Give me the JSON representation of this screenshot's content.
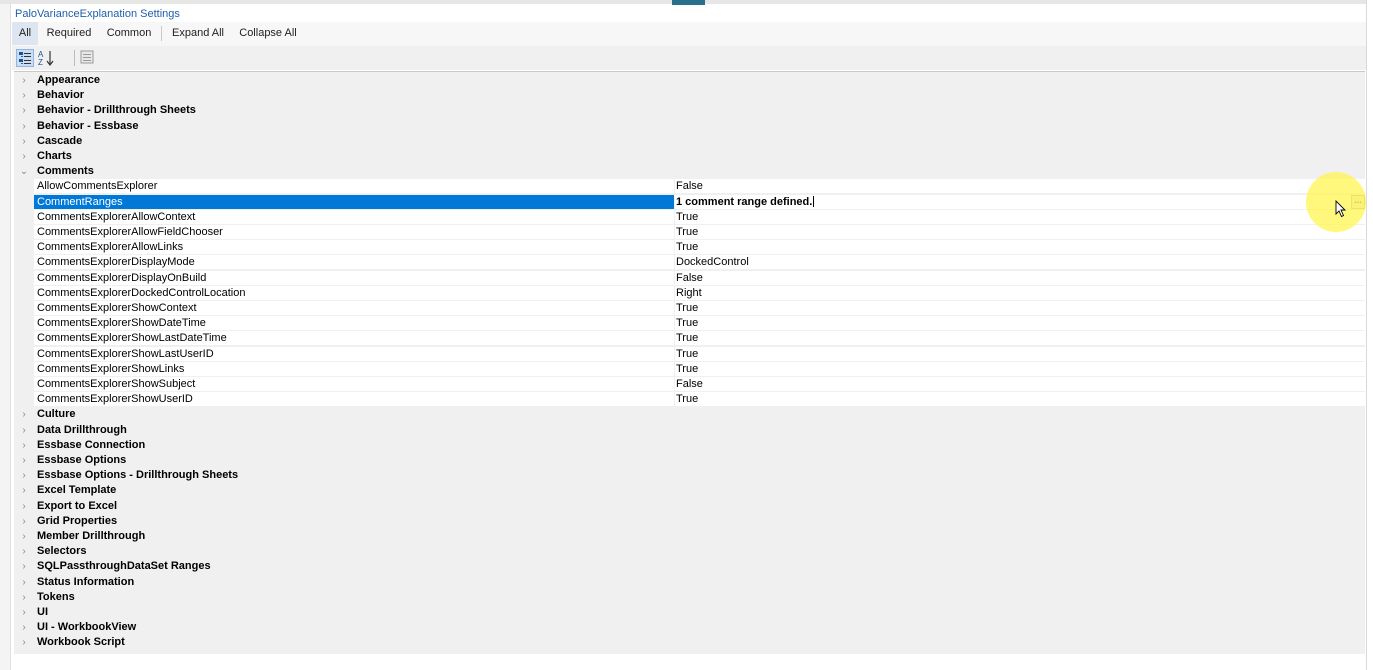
{
  "panel": {
    "title": "PaloVarianceExplanation Settings"
  },
  "filters": {
    "all": "All",
    "required": "Required",
    "common": "Common",
    "expand_all": "Expand All",
    "collapse_all": "Collapse All"
  },
  "icons": {
    "categorized": "categorized-view-icon",
    "alphabetical": "alphabetical-sort-icon",
    "property_pages": "property-pages-icon",
    "collapsed": "chevron-right-icon",
    "expanded": "chevron-down-icon",
    "ellipsis": "ellipsis-icon",
    "cursor": "mouse-pointer-icon"
  },
  "glyphs": {
    "collapsed": "›",
    "expanded": "⌄",
    "ellipsis": "..."
  },
  "colors": {
    "selection": "#0078d7",
    "title": "#1f5fa8",
    "highlight": "#fff650"
  },
  "categories_before": [
    "Appearance",
    "Behavior",
    "Behavior - Drillthrough Sheets",
    "Behavior - Essbase",
    "Cascade",
    "Charts"
  ],
  "expanded_category": {
    "label": "Comments",
    "properties": [
      {
        "name": "AllowCommentsExplorer",
        "value": "False"
      },
      {
        "name": "CommentRanges",
        "value": "1 comment range defined."
      },
      {
        "name": "CommentsExplorerAllowContext",
        "value": "True"
      },
      {
        "name": "CommentsExplorerAllowFieldChooser",
        "value": "True"
      },
      {
        "name": "CommentsExplorerAllowLinks",
        "value": "True"
      },
      {
        "name": "CommentsExplorerDisplayMode",
        "value": "DockedControl"
      },
      {
        "name": "CommentsExplorerDisplayOnBuild",
        "value": "False"
      },
      {
        "name": "CommentsExplorerDockedControlLocation",
        "value": "Right"
      },
      {
        "name": "CommentsExplorerShowContext",
        "value": "True"
      },
      {
        "name": "CommentsExplorerShowDateTime",
        "value": "True"
      },
      {
        "name": "CommentsExplorerShowLastDateTime",
        "value": "True"
      },
      {
        "name": "CommentsExplorerShowLastUserID",
        "value": "True"
      },
      {
        "name": "CommentsExplorerShowLinks",
        "value": "True"
      },
      {
        "name": "CommentsExplorerShowSubject",
        "value": "False"
      },
      {
        "name": "CommentsExplorerShowUserID",
        "value": "True"
      }
    ],
    "selected_property": "CommentRanges"
  },
  "categories_after": [
    "Culture",
    "Data Drillthrough",
    "Essbase Connection",
    "Essbase Options",
    "Essbase Options - Drillthrough Sheets",
    "Excel Template",
    "Export to Excel",
    "Grid Properties",
    "Member Drillthrough",
    "Selectors",
    "SQLPassthroughDataSet Ranges",
    "Status Information",
    "Tokens",
    "UI",
    "UI - WorkbookView",
    "Workbook Script"
  ]
}
